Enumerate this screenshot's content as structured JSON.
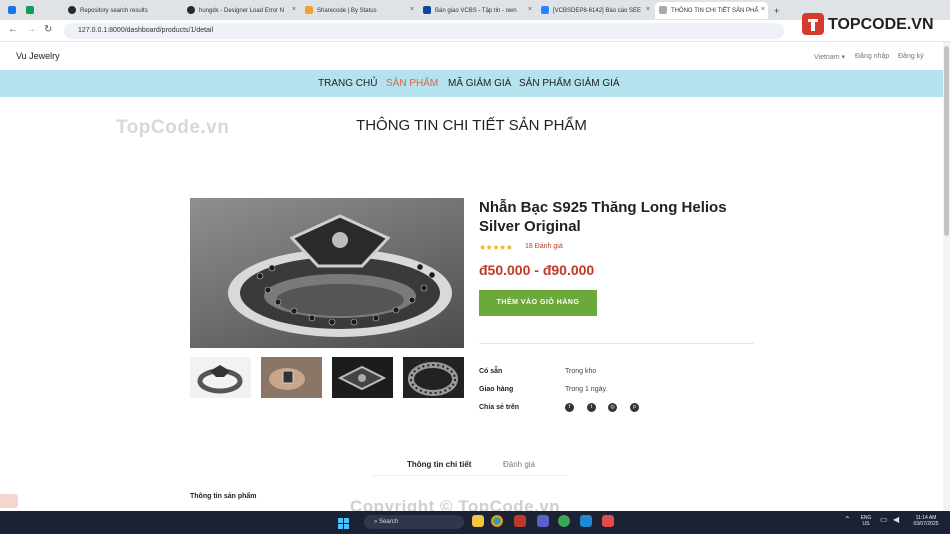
{
  "browser": {
    "tabs": [
      {
        "label": "",
        "fav": "#1a73e8"
      },
      {
        "label": "",
        "fav": "#0f9d58"
      },
      {
        "label": "Repository search results",
        "fav": "#24292f"
      },
      {
        "label": "hungdx - Designer Load Error N",
        "fav": "#24292f"
      },
      {
        "label": "Sharecode | By Status",
        "fav": "#f0a030"
      },
      {
        "label": "Bàn giao VCBS - Tập tin - own",
        "fav": "#0d47a1"
      },
      {
        "label": "[VCBSDEP8-6142] Báo cáo SEE",
        "fav": "#2684ff"
      },
      {
        "label": "THÔNG TIN CHI TIẾT SẢN PHẨ",
        "fav": "#aaaaaa"
      }
    ],
    "new_tab": "+",
    "url": "127.0.0.1:8000/dashboard/products/1/detail"
  },
  "site": {
    "brand": "Vu Jewelry",
    "topcode_logo": "TOPCODE.VN",
    "language": "Vietnam",
    "login": "Đăng nhập",
    "register": "Đăng ký",
    "menu": [
      "TRANG CHỦ",
      "SẢN PHẨM",
      "MÃ GIẢM GIÁ",
      "SẢN PHẨM GIẢM GIÁ"
    ],
    "active_menu": 1,
    "watermark": "TopCode.vn",
    "watermark_bottom": "Copyright © TopCode.vn"
  },
  "page_title": "THÔNG TIN CHI TIẾT SẢN PHẨM",
  "product": {
    "name": "Nhẫn Bạc S925 Thăng Long Helios Silver Original",
    "rating": 5,
    "reviews": "18 Đánh giá",
    "price": "đ50.000 - đ90.000",
    "add_to_cart": "THÊM VÀO GIỎ HÀNG",
    "details": [
      {
        "label": "Có sẵn",
        "value": "Trong kho"
      },
      {
        "label": "Giao hàng",
        "value": "Trong 1 ngày."
      }
    ],
    "share_label": "Chia sẻ trên",
    "share_icons": [
      "facebook-icon",
      "twitter-icon",
      "instagram-icon",
      "pinterest-icon"
    ]
  },
  "tabs": {
    "info": "Thông tin chi tiết",
    "reviews": "Đánh giá"
  },
  "info_heading": "Thông tin sản phẩm",
  "taskbar": {
    "search_placeholder": "Search",
    "lang": "ENG",
    "region": "US",
    "time": "11:14 AM",
    "date": "03/07/2025"
  }
}
